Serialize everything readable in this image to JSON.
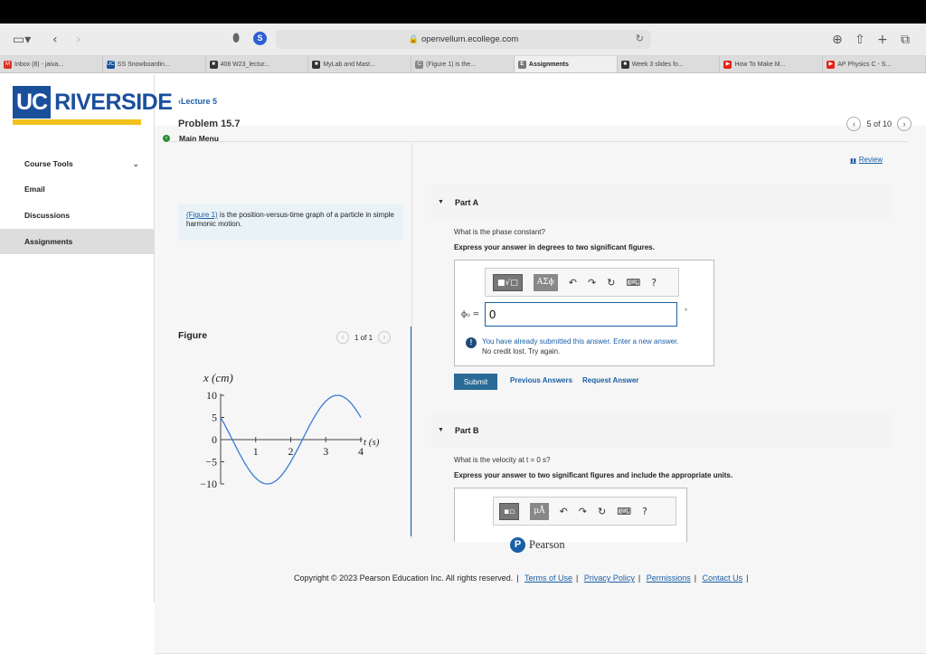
{
  "browser": {
    "address": "openvellum.ecollege.com",
    "s_badge": "S",
    "tabs": [
      {
        "label": "Inbox (8) - jaiva...",
        "fav": "M",
        "color": "#d93025",
        "active": false
      },
      {
        "label": "SS Snowboardin...",
        "fav": "UC",
        "color": "#1a4f9c",
        "active": false
      },
      {
        "label": "408 W23_lectur...",
        "fav": "■",
        "color": "#333333",
        "active": false
      },
      {
        "label": "MyLab and Mast...",
        "fav": "■",
        "color": "#333333",
        "active": false
      },
      {
        "label": "(Figure 1) is the...",
        "fav": "C",
        "color": "#888888",
        "active": false
      },
      {
        "label": "Assignments",
        "fav": "E",
        "color": "#777777",
        "active": true
      },
      {
        "label": "Week 3 slides fo...",
        "fav": "■",
        "color": "#333333",
        "active": false
      },
      {
        "label": "How To Make M...",
        "fav": "▶",
        "color": "#e62117",
        "active": false
      },
      {
        "label": "AP Physics C - S...",
        "fav": "▶",
        "color": "#e62117",
        "active": false
      }
    ]
  },
  "sidebar": {
    "logo_uc": "UC",
    "logo_riv": "RIVERSIDE",
    "main_menu": "Main Menu",
    "items": [
      {
        "label": "Course Tools"
      },
      {
        "label": "Email"
      },
      {
        "label": "Discussions"
      },
      {
        "label": "Assignments"
      }
    ]
  },
  "page": {
    "breadcrumb": "Lecture 5",
    "title": "Problem 15.7",
    "pager": "5 of 10",
    "review": "Review",
    "intro_link": "(Figure 1)",
    "intro_text": " is the position-versus-time graph of a particle in simple harmonic motion.",
    "figure_label": "Figure",
    "figure_pager": "1 of 1"
  },
  "graph": {
    "ylabel": "x (cm)",
    "xlabel": "t (s)",
    "yticks": [
      "10",
      "5",
      "0",
      "−5",
      "−10"
    ],
    "xticks": [
      "1",
      "2",
      "3",
      "4"
    ]
  },
  "chart_data": {
    "type": "line",
    "title": "",
    "xlabel": "t (s)",
    "ylabel": "x (cm)",
    "xlim": [
      0,
      4
    ],
    "ylim": [
      -10,
      10
    ],
    "x": [
      0,
      0.5,
      1,
      1.5,
      2,
      2.5,
      3,
      3.5,
      4
    ],
    "series": [
      {
        "values": [
          5,
          -3.2,
          -9.3,
          -8.4,
          -1.6,
          6.4,
          9.9,
          7.9,
          1.8
        ]
      }
    ]
  },
  "partA": {
    "head": "Part A",
    "question": "What is the phase constant?",
    "instruction": "Express your answer in degrees to two significant figures.",
    "tool_sqrt": "■√□",
    "tool_greek": "AΣϕ",
    "tool_help": "?",
    "phi_label": "ϕ₀ =",
    "answer": "0",
    "unit": "°",
    "warn_title": "You have already submitted this answer. Enter a new answer.",
    "warn_sub": "No credit lost. Try again.",
    "submit": "Submit",
    "previous": "Previous Answers",
    "request": "Request Answer"
  },
  "partB": {
    "head": "Part B",
    "question": "What is the velocity at t = 0 s?",
    "instruction": "Express your answer to two significant figures and include the appropriate units.",
    "tool_units": "μÅ",
    "tool_help": "?"
  },
  "footer": {
    "brand": "Pearson",
    "copyright": "Copyright © 2023 Pearson Education Inc. All rights reserved.",
    "links": [
      "Terms of Use",
      "Privacy Policy",
      "Permissions",
      "Contact Us"
    ]
  }
}
